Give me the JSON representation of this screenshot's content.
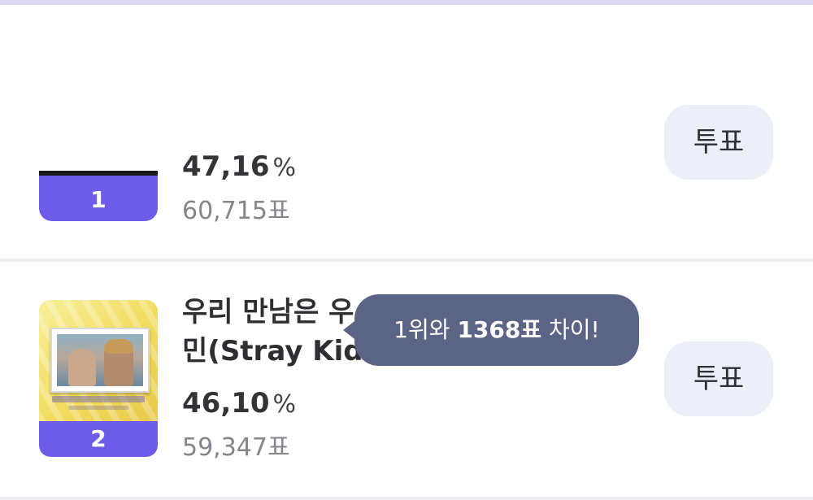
{
  "entries": [
    {
      "rank": "1",
      "percent": "47,16",
      "percent_unit": "%",
      "votes": "60,715표",
      "vote_button_label": "투표"
    },
    {
      "rank": "2",
      "title_line1": "우리 만남은 우",
      "title_line2": "민(Stray Kids)",
      "percent": "46,10",
      "percent_unit": "%",
      "votes": "59,347표",
      "vote_button_label": "투표"
    }
  ],
  "tooltip": {
    "prefix": "1위와 ",
    "highlight": "1368표",
    "suffix": " 차이!"
  },
  "colors": {
    "rank_tab": "#6c5ce7",
    "vote_button_bg": "#eceef8",
    "tooltip_bg": "#5b6485"
  }
}
